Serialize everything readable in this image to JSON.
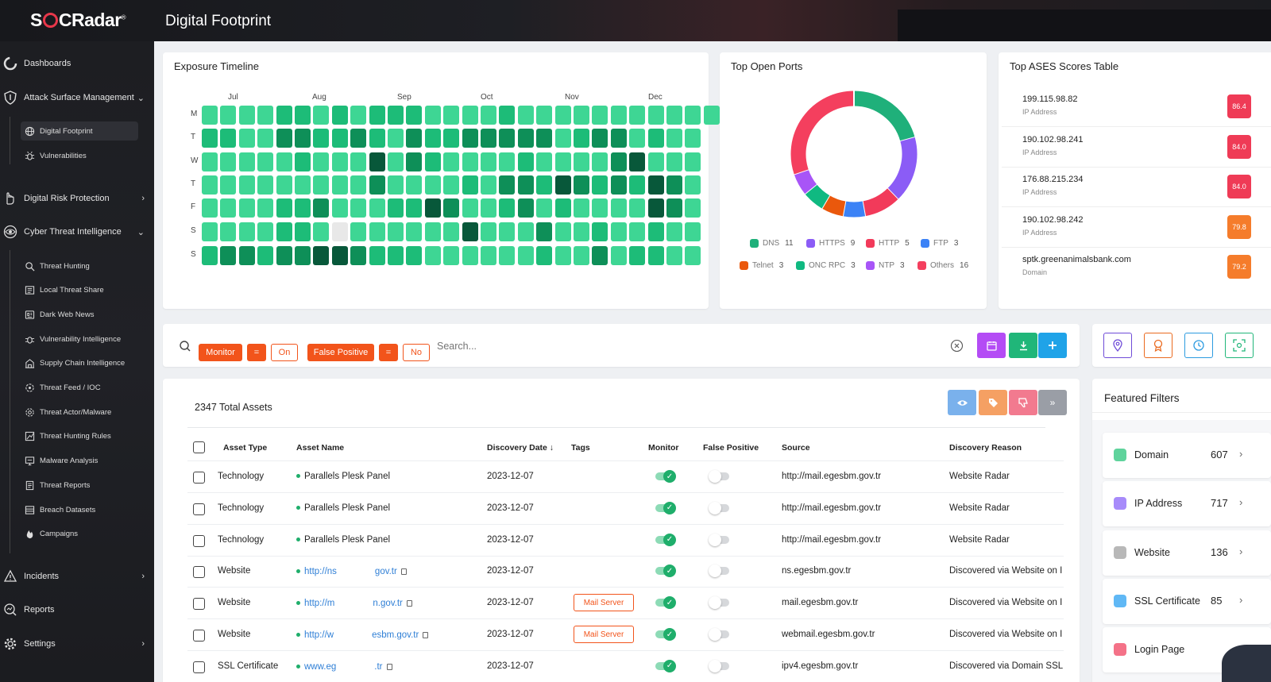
{
  "header": {
    "logo": "SOCRadar",
    "logo_mark": "®",
    "title": "Digital Footprint"
  },
  "sidebar": {
    "main": [
      {
        "label": "Dashboards",
        "icon": "dashboard-icon"
      },
      {
        "label": "Attack Surface Management",
        "icon": "shield-icon",
        "chevron": "⌄"
      },
      {
        "label": "Digital Risk Protection",
        "icon": "hand-icon",
        "chevron": "›"
      },
      {
        "label": "Cyber Threat Intelligence",
        "icon": "eye-icon",
        "chevron": "⌄"
      },
      {
        "label": "Incidents",
        "icon": "alert-icon",
        "chevron": "›"
      },
      {
        "label": "Reports",
        "icon": "report-icon"
      },
      {
        "label": "Settings",
        "icon": "gear-icon",
        "chevron": "›"
      }
    ],
    "asm_sub": [
      {
        "label": "Digital Footprint",
        "icon": "globe-icon"
      },
      {
        "label": "Vulnerabilities",
        "icon": "bug-icon"
      }
    ],
    "cti_sub": [
      {
        "label": "Threat Hunting",
        "icon": "magnifier-icon"
      },
      {
        "label": "Local Threat Share",
        "icon": "share-icon"
      },
      {
        "label": "Dark Web News",
        "icon": "news-icon"
      },
      {
        "label": "Vulnerability Intelligence",
        "icon": "bug-icon"
      },
      {
        "label": "Supply Chain Intelligence",
        "icon": "building-icon"
      },
      {
        "label": "Threat Feed / IOC",
        "icon": "feed-icon"
      },
      {
        "label": "Threat Actor/Malware",
        "icon": "actor-icon"
      },
      {
        "label": "Threat Hunting Rules",
        "icon": "rules-icon"
      },
      {
        "label": "Malware Analysis",
        "icon": "monitor-icon"
      },
      {
        "label": "Threat Reports",
        "icon": "document-icon"
      },
      {
        "label": "Breach Datasets",
        "icon": "database-icon"
      },
      {
        "label": "Campaigns",
        "icon": "flame-icon"
      }
    ]
  },
  "exposure": {
    "title": "Exposure Timeline",
    "months": [
      "Jul",
      "Aug",
      "Sep",
      "Oct",
      "Nov",
      "Dec"
    ],
    "days": [
      "M",
      "T",
      "W",
      "T",
      "F",
      "S",
      "S"
    ],
    "levels": [
      "0000110101110000100000000000",
      "110022112102112222201220100",
      "000001000302100001000023000",
      "000000000200001022132121320",
      "000011200011320012010000320",
      "000011010000003000200100100",
      "122122332111000000100201100"
    ],
    "palette": [
      "#3ed694",
      "#1dbc78",
      "#0e8f58",
      "#08583a"
    ],
    "empty_color": "#e8e8e8"
  },
  "ports": {
    "title": "Top Open Ports",
    "chart_data": {
      "type": "pie",
      "donut": true,
      "slices": [
        {
          "label": "DNS",
          "value": 11,
          "color": "#1fb07a"
        },
        {
          "label": "HTTPS",
          "value": 9,
          "color": "#8b5cf6"
        },
        {
          "label": "HTTP",
          "value": 5,
          "color": "#f23a5a"
        },
        {
          "label": "FTP",
          "value": 3,
          "color": "#3b82f6"
        },
        {
          "label": "Telnet",
          "value": 3,
          "color": "#ea580c"
        },
        {
          "label": "ONC RPC",
          "value": 3,
          "color": "#10b981"
        },
        {
          "label": "NTP",
          "value": 3,
          "color": "#a855f7"
        },
        {
          "label": "Others",
          "value": 16,
          "color": "#f43f5e"
        }
      ]
    }
  },
  "ases": {
    "title": "Top ASES Scores Table",
    "rows": [
      {
        "name": "199.115.98.82",
        "type": "IP Address",
        "score": "86.4",
        "color": "#ef3b56"
      },
      {
        "name": "190.102.98.241",
        "type": "IP Address",
        "score": "84.0",
        "color": "#ef3b56"
      },
      {
        "name": "176.88.215.234",
        "type": "IP Address",
        "score": "84.0",
        "color": "#ef3b56"
      },
      {
        "name": "190.102.98.242",
        "type": "IP Address",
        "score": "79.8",
        "color": "#f57c2b"
      },
      {
        "name": "sptk.greenanimalsbank.com",
        "type": "Domain",
        "score": "79.2",
        "color": "#f57c2b"
      }
    ]
  },
  "filterbar": {
    "chips": [
      "Monitor",
      "=",
      "On",
      "False Positive",
      "=",
      "No"
    ],
    "search_placeholder": "Search..."
  },
  "assets": {
    "total_label": "2347 Total Assets",
    "columns": [
      "Asset Type",
      "Asset Name",
      "Discovery Date",
      "Tags",
      "Monitor",
      "False Positive",
      "Source",
      "Discovery Reason"
    ],
    "sort_indicator": "↓",
    "rows": [
      {
        "type": "Technology",
        "name": "Parallels Plesk Panel",
        "link": false,
        "date": "2023-12-07",
        "tag": "",
        "source": "http://mail.egesbm.gov.tr",
        "reason": "Website Radar"
      },
      {
        "type": "Technology",
        "name": "Parallels Plesk Panel",
        "link": false,
        "date": "2023-12-07",
        "tag": "",
        "source": "http://mail.egesbm.gov.tr",
        "reason": "Website Radar"
      },
      {
        "type": "Technology",
        "name": "Parallels Plesk Panel",
        "link": false,
        "date": "2023-12-07",
        "tag": "",
        "source": "http://mail.egesbm.gov.tr",
        "reason": "Website Radar"
      },
      {
        "type": "Website",
        "name": "http://ns",
        "name_tail": "gov.tr",
        "link": true,
        "date": "2023-12-07",
        "tag": "",
        "source": "ns.egesbm.gov.tr",
        "reason": "Discovered via Website on I"
      },
      {
        "type": "Website",
        "name": "http://m",
        "name_tail": "n.gov.tr",
        "link": true,
        "date": "2023-12-07",
        "tag": "Mail Server",
        "source": "mail.egesbm.gov.tr",
        "reason": "Discovered via Website on I"
      },
      {
        "type": "Website",
        "name": "http://w",
        "name_tail": "esbm.gov.tr",
        "link": true,
        "date": "2023-12-07",
        "tag": "Mail Server",
        "source": "webmail.egesbm.gov.tr",
        "reason": "Discovered via Website on I"
      },
      {
        "type": "SSL Certificate",
        "name": "www.eg",
        "name_tail": ".tr",
        "link": true,
        "date": "2023-12-07",
        "tag": "",
        "source": "ipv4.egesbm.gov.tr",
        "reason": "Discovered via Domain SSL"
      }
    ]
  },
  "featured": {
    "title": "Featured Filters",
    "items": [
      {
        "label": "Domain",
        "count": "607",
        "color": "#5fd39c"
      },
      {
        "label": "IP Address",
        "count": "717",
        "color": "#a78bfa"
      },
      {
        "label": "Website",
        "count": "136",
        "color": "#b8b8b8"
      },
      {
        "label": "SSL Certificate",
        "count": "85",
        "color": "#60b8f5"
      },
      {
        "label": "Login Page",
        "count": "",
        "color": "#f47288"
      }
    ]
  }
}
